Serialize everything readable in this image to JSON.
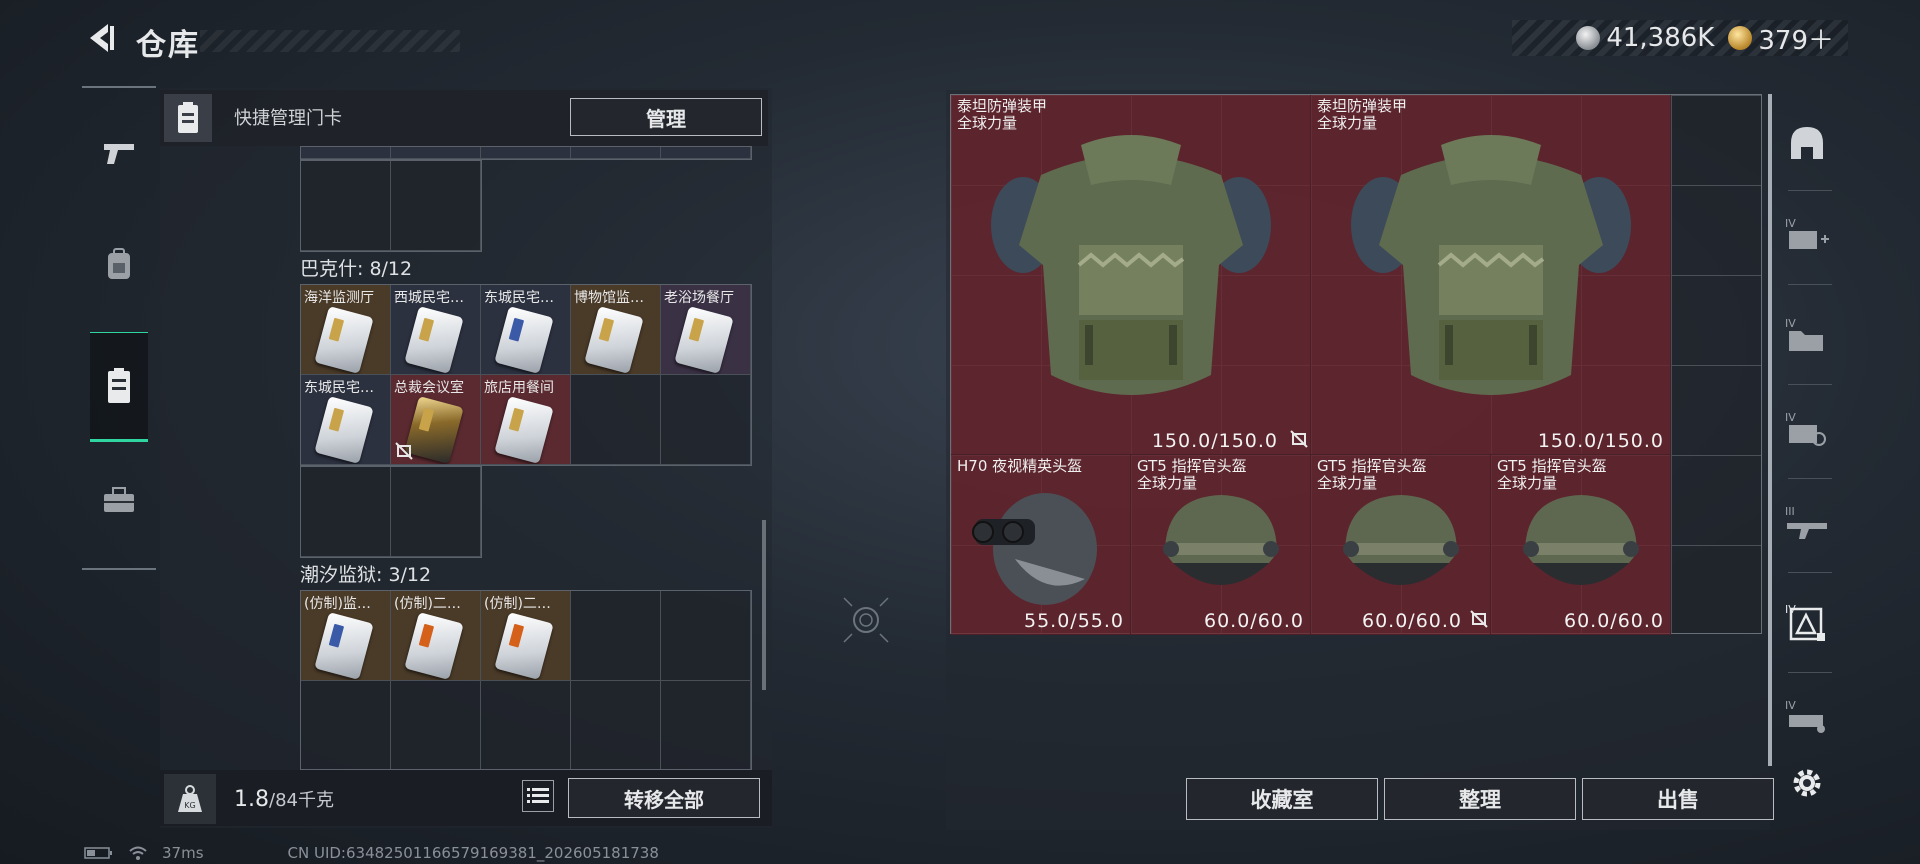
{
  "header": {
    "title": "仓库",
    "currency": [
      {
        "icon": "silver-coin-icon",
        "value": "41,386K"
      },
      {
        "icon": "gold-coin-icon",
        "value": "379＋"
      }
    ]
  },
  "left_rail": {
    "items": [
      {
        "icon": "gun-icon",
        "active": false
      },
      {
        "icon": "backpack-icon",
        "active": false
      },
      {
        "icon": "keycard-icon",
        "active": true
      },
      {
        "icon": "toolbox-icon",
        "active": false
      }
    ]
  },
  "quick_manage": {
    "label": "快捷管理门卡",
    "button": "管理"
  },
  "groups": [
    {
      "title": "巴克什: 8/12",
      "cards": [
        "海洋监测厅",
        "西城民宅…",
        "东城民宅…",
        "博物馆监…",
        "老浴场餐厅",
        "东城民宅…",
        "总裁会议室",
        "旅店用餐间"
      ]
    },
    {
      "title": "潮汐监狱: 3/12",
      "cards": [
        "(仿制)监…",
        "(仿制)二…",
        "(仿制)二…"
      ]
    }
  ],
  "weight": {
    "current": "1.8",
    "capacity": "/84千克"
  },
  "buttons": {
    "transfer_all": "转移全部",
    "collection": "收藏室",
    "organize": "整理",
    "sell": "出售"
  },
  "status": {
    "ping": "37ms",
    "uid": "CN UID:63482501166579169381_202605181738"
  },
  "stash_items": [
    {
      "name": "泰坦防弹装甲",
      "sub": "全球力量",
      "durability": "150.0/150.0"
    },
    {
      "name": "泰坦防弹装甲",
      "sub": "全球力量",
      "durability": "150.0/150.0"
    },
    {
      "name": "H70 夜视精英头盔",
      "sub": "",
      "durability": "55.0/55.0"
    },
    {
      "name": "GT5 指挥官头盔",
      "sub": "全球力量",
      "durability": "60.0/60.0"
    },
    {
      "name": "GT5 指挥官头盔",
      "sub": "全球力量",
      "durability": "60.0/60.0"
    },
    {
      "name": "GT5 指挥官头盔",
      "sub": "全球力量",
      "durability": "60.0/60.0"
    }
  ],
  "right_rail": {
    "items": [
      "dome-icon",
      "tier-iv-add-icon",
      "tier-iv-folder-icon",
      "tier-iv-search-icon",
      "tier-iii-rifle-icon",
      "tier-iv-triangle-icon",
      "tier-iv-vehicle-icon",
      "gear-icon"
    ]
  },
  "colors": {
    "accent": "#2fd6a0",
    "item_red": "#70242c"
  }
}
